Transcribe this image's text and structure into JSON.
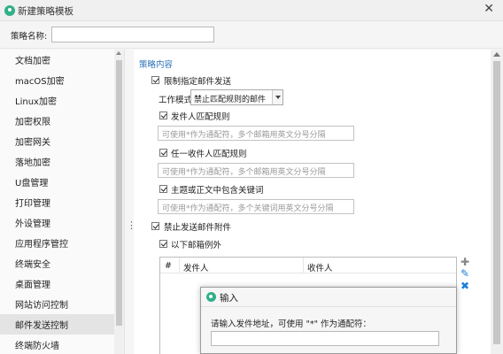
{
  "window": {
    "title": "新建策略模板",
    "close_glyph": "✕"
  },
  "namebar": {
    "label": "策略名称:",
    "value": ""
  },
  "sidebar": {
    "items": [
      "文档加密",
      "macOS加密",
      "Linux加密",
      "加密权限",
      "加密网关",
      "落地加密",
      "U盘管理",
      "打印管理",
      "外设管理",
      "应用程序管控",
      "终端安全",
      "桌面管理",
      "网站访问控制",
      "邮件发送控制",
      "终端防火墙"
    ],
    "active_index": 13
  },
  "splitter": {
    "glyph": "⋮"
  },
  "content": {
    "section_title": "策略内容",
    "limit_send": {
      "label": "限制指定邮件发送",
      "checked": true
    },
    "work_mode": {
      "label": "工作模式",
      "selected": "禁止匹配规则的邮件"
    },
    "sender_match": {
      "label": "发件人匹配规则",
      "checked": true,
      "placeholder": "可使用*作为通配符，多个邮箱用英文分号分隔"
    },
    "any_recipient": {
      "label": "任一收件人匹配规则",
      "checked": true,
      "placeholder": "可使用*作为通配符，多个邮箱用英文分号分隔"
    },
    "keywords": {
      "label": "主题或正文中包含关键词",
      "checked": true,
      "placeholder": "可使用*作为通配符，多个关键词用英文分号分隔"
    },
    "block_attach": {
      "label": "禁止发送邮件附件",
      "checked": true
    },
    "exceptions": {
      "label": "以下邮箱例外",
      "checked": true,
      "columns": [
        "#",
        "发件人",
        "收件人"
      ]
    },
    "icons": {
      "add": {
        "name": "plus-icon",
        "glyph": "✚"
      },
      "edit": {
        "name": "pencil-icon",
        "glyph": "✎"
      },
      "delete": {
        "name": "x-icon",
        "glyph": "✖"
      }
    },
    "colors": {
      "accent": "#2a72b8",
      "icon_blue": "#1d7fd6",
      "logo": "#2fb089"
    }
  },
  "dialog": {
    "title": "输入",
    "prompt": "请输入发件地址，可使用 \"*\" 作为通配符：",
    "value": ""
  }
}
